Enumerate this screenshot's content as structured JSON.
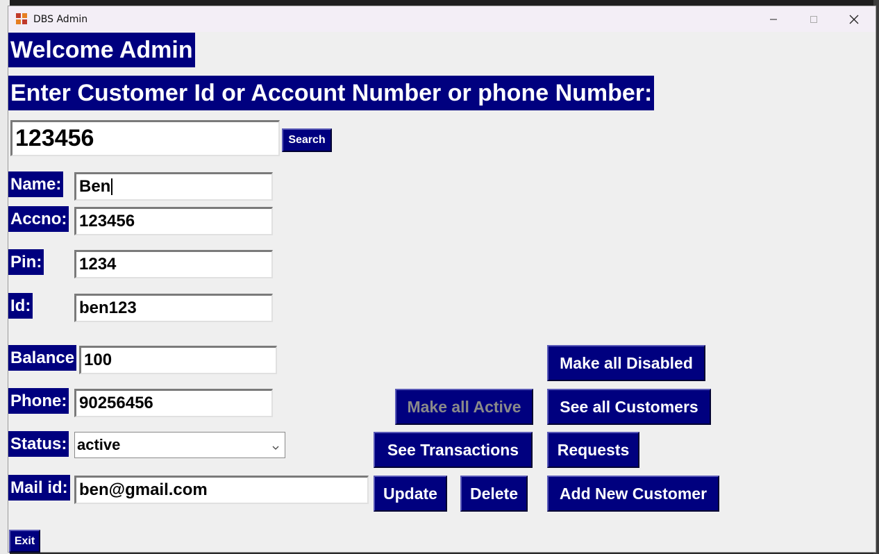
{
  "window": {
    "title": "DBS Admin"
  },
  "header": {
    "welcome": "Welcome Admin",
    "search_prompt": "Enter Customer Id or Account Number or phone Number:"
  },
  "search": {
    "value": "123456",
    "button": "Search"
  },
  "fields": {
    "name": {
      "label": "Name:",
      "value": "Ben"
    },
    "accno": {
      "label": "Accno:",
      "value": "123456"
    },
    "pin": {
      "label": "Pin:",
      "value": "1234"
    },
    "id": {
      "label": "Id:",
      "value": "ben123"
    },
    "balance": {
      "label": "Balance",
      "value": "100"
    },
    "phone": {
      "label": "Phone:",
      "value": "90256456"
    },
    "status": {
      "label": "Status:",
      "value": "active"
    },
    "mail": {
      "label": "Mail id:",
      "value": "ben@gmail.com"
    }
  },
  "buttons": {
    "make_all_disabled": "Make all Disabled",
    "make_all_active": "Make all Active",
    "see_all_customers": "See all Customers",
    "see_transactions": "See Transactions",
    "requests": "Requests",
    "update": "Update",
    "delete": "Delete",
    "add_new_customer": "Add New Customer",
    "exit": "Exit"
  },
  "colors": {
    "accent": "#00007f",
    "window_bg": "#efefef"
  }
}
